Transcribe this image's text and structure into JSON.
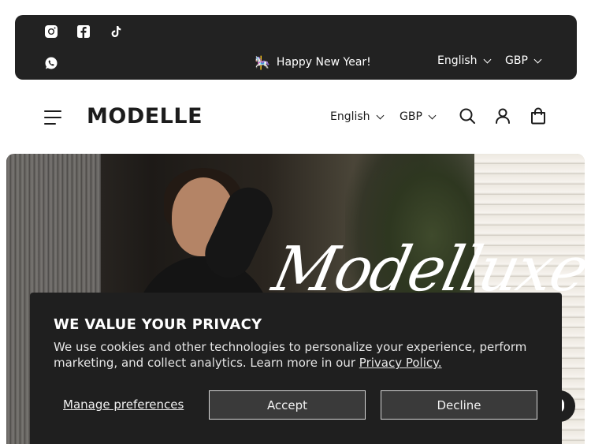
{
  "announcement_bar": {
    "social_icons": [
      "instagram-icon",
      "facebook-icon",
      "tiktok-icon",
      "whatsapp-icon"
    ],
    "message_emoji": "🎠",
    "message": "Happy New Year!",
    "language": "English",
    "currency": "GBP"
  },
  "header": {
    "logo": "MODELLE",
    "language": "English",
    "currency": "GBP",
    "icons": [
      "menu-icon",
      "search-icon",
      "account-icon",
      "cart-icon"
    ]
  },
  "hero": {
    "script_title": "Modelluxe"
  },
  "cookie_banner": {
    "title": "WE VALUE YOUR PRIVACY",
    "text": "We use cookies and other technologies to personalize your experience, perform marketing, and collect analytics. Learn more in our ",
    "policy_link": "Privacy Policy.",
    "manage_label": "Manage preferences",
    "accept_label": "Accept",
    "decline_label": "Decline"
  },
  "colors": {
    "announcement_bg": "#222222",
    "banner_bg": "#1f1f1f",
    "text_dark": "#1c1c1c"
  }
}
